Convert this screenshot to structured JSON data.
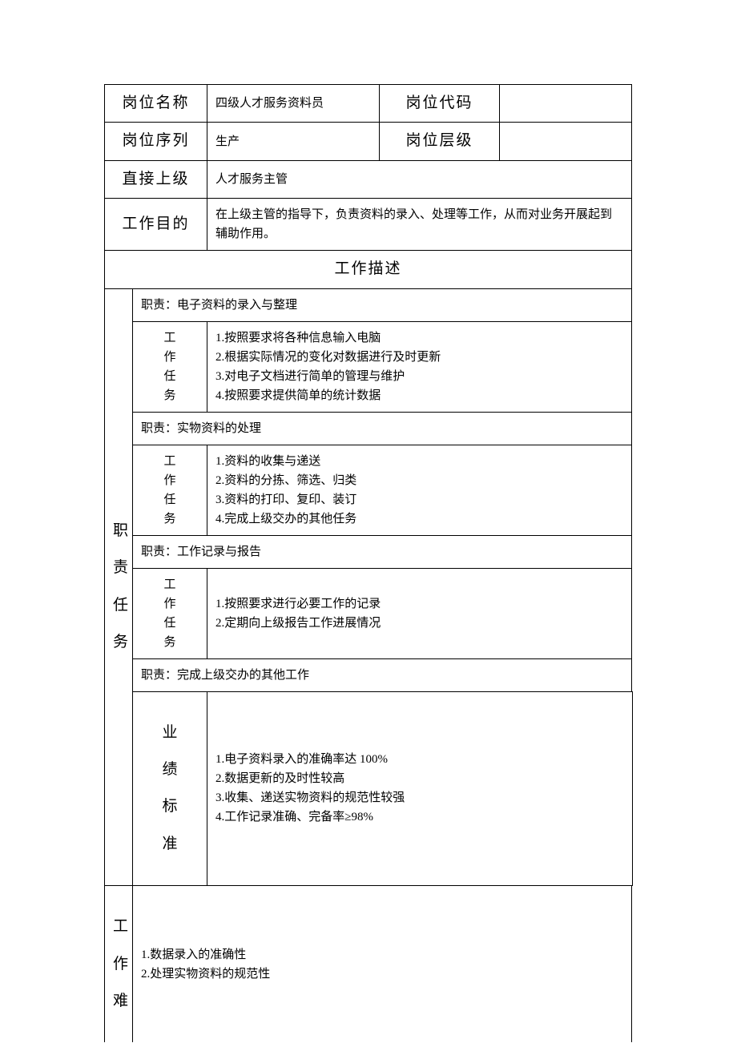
{
  "header": {
    "r1c1_label": "岗位名称",
    "r1c2_value": "四级人才服务资料员",
    "r1c3_label": "岗位代码",
    "r1c4_value": "",
    "r2c1_label": "岗位序列",
    "r2c2_value": "生产",
    "r2c3_label": "岗位层级",
    "r2c4_value": "",
    "r3c1_label": "直接上级",
    "r3c2_value": "人才服务主管",
    "r4c1_label": "工作目的",
    "r4c2_value": "在上级主管的指导下，负责资料的录入、处理等工作，从而对业务开展起到辅助作用。"
  },
  "desc_title": "工作描述",
  "duties_label": "职责任务",
  "duty1": {
    "title": "职责：电子资料的录入与整理",
    "task_label": "工作任务",
    "tasks": "1.按照要求将各种信息输入电脑\n2.根据实际情况的变化对数据进行及时更新\n3.对电子文档进行简单的管理与维护\n4.按照要求提供简单的统计数据"
  },
  "duty2": {
    "title": "职责：实物资料的处理",
    "task_label": "工作任务",
    "tasks": "1.资料的收集与递送\n2.资料的分拣、筛选、归类\n3.资料的打印、复印、装订\n4.完成上级交办的其他任务"
  },
  "duty3": {
    "title": "职责：工作记录与报告",
    "task_label": "工作任务",
    "tasks": "1.按照要求进行必要工作的记录\n2.定期向上级报告工作进展情况"
  },
  "duty4": {
    "title": "职责：完成上级交办的其他工作"
  },
  "perf": {
    "label": "业绩标准",
    "text": "1.电子资料录入的准确率达 100%\n2.数据更新的及时性较高\n3.收集、递送实物资料的规范性较强\n4.工作记录准确、完备率≥98%"
  },
  "diff": {
    "label": "工作难",
    "text": "1.数据录入的准确性\n2.处理实物资料的规范性"
  }
}
